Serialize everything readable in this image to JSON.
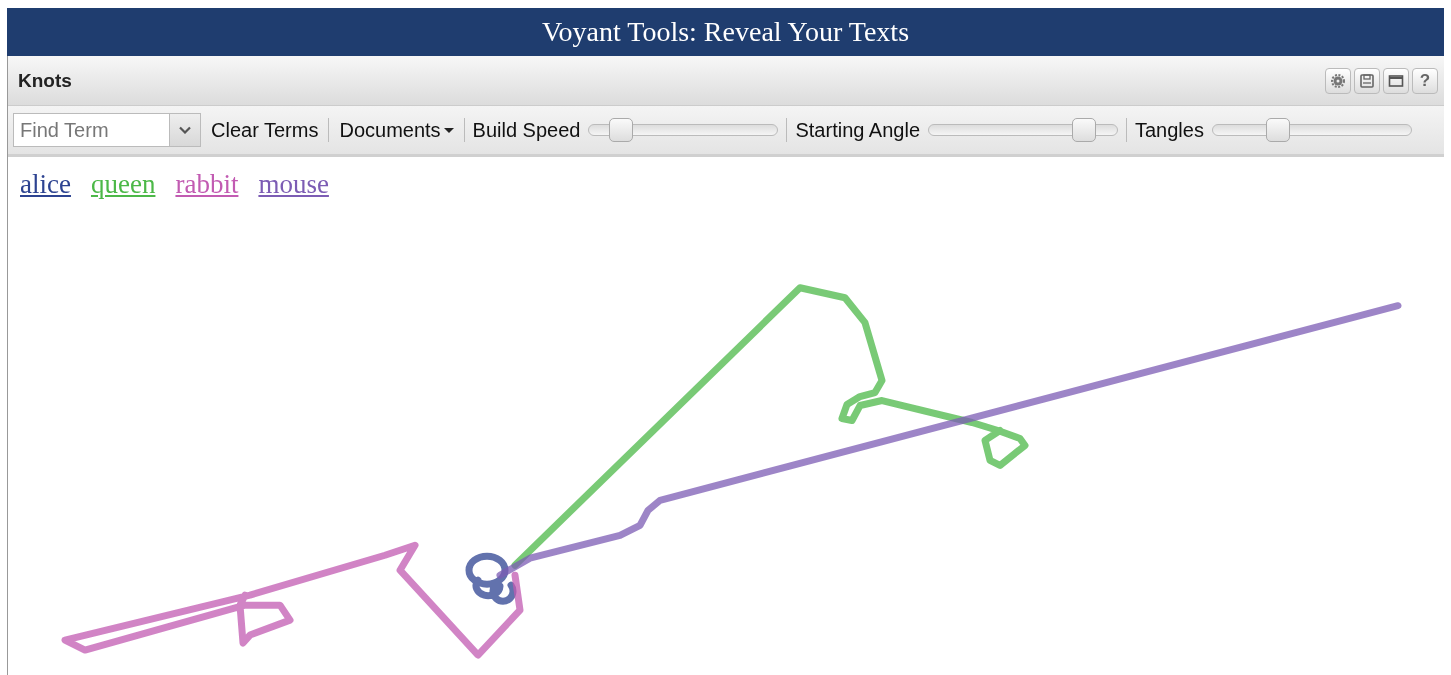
{
  "header": {
    "title": "Voyant Tools: Reveal Your Texts"
  },
  "panel": {
    "title": "Knots",
    "tools": [
      {
        "kind": "gear"
      },
      {
        "kind": "save"
      },
      {
        "kind": "maximize"
      },
      {
        "kind": "help",
        "label": "?"
      }
    ]
  },
  "toolbar": {
    "search": {
      "placeholder": "Find Term"
    },
    "clear_button": "Clear Terms",
    "documents_menu": "Documents",
    "sliders": [
      {
        "label": "Build Speed",
        "level": 0.17
      },
      {
        "label": "Starting Angle",
        "level": 0.82
      },
      {
        "label": "Tangles",
        "level": 0.33
      }
    ]
  },
  "terms": [
    {
      "label": "alice",
      "color": "#2d4391"
    },
    {
      "label": "queen",
      "color": "#4cb848"
    },
    {
      "label": "rabbit",
      "color": "#c25bb2"
    },
    {
      "label": "mouse",
      "color": "#7c5cb4"
    }
  ]
}
